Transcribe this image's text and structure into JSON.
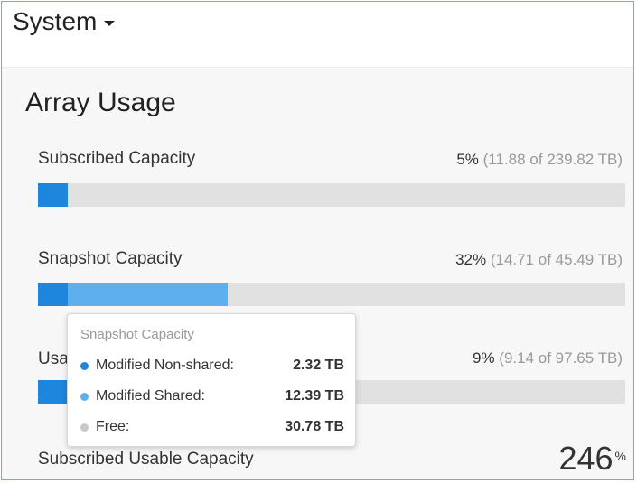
{
  "header": {
    "system_label": "System"
  },
  "panel": {
    "title": "Array Usage"
  },
  "metrics": [
    {
      "label": "Subscribed Capacity",
      "percent": "5%",
      "detail": "(11.88 of 239.82 TB)",
      "segments": [
        {
          "name": "used",
          "fraction": 0.05,
          "color": "#1e86dc"
        }
      ]
    },
    {
      "label": "Snapshot Capacity",
      "percent": "32%",
      "detail": "(14.71 of 45.49 TB)",
      "segments": [
        {
          "name": "modified-non-shared",
          "fraction": 0.051,
          "color": "#1e86dc"
        },
        {
          "name": "modified-shared",
          "fraction": 0.272,
          "color": "#5dafed"
        }
      ]
    },
    {
      "label": "Usa",
      "percent": "9%",
      "detail": "(9.14 of 97.65 TB)",
      "segments": [
        {
          "name": "used",
          "fraction": 0.094,
          "color": "#1e86dc"
        }
      ]
    }
  ],
  "subscribed_usable": {
    "label": "Subscribed Usable Capacity",
    "value": "246",
    "unit": "%"
  },
  "tooltip": {
    "title": "Snapshot Capacity",
    "rows": [
      {
        "name": "Modified Non-shared:",
        "value": "2.32 TB",
        "color": "#1e86dc"
      },
      {
        "name": "Modified Shared:",
        "value": "12.39 TB",
        "color": "#5dafed"
      },
      {
        "name": "Free:",
        "value": "30.78 TB",
        "color": "#c8c8c8"
      }
    ]
  }
}
